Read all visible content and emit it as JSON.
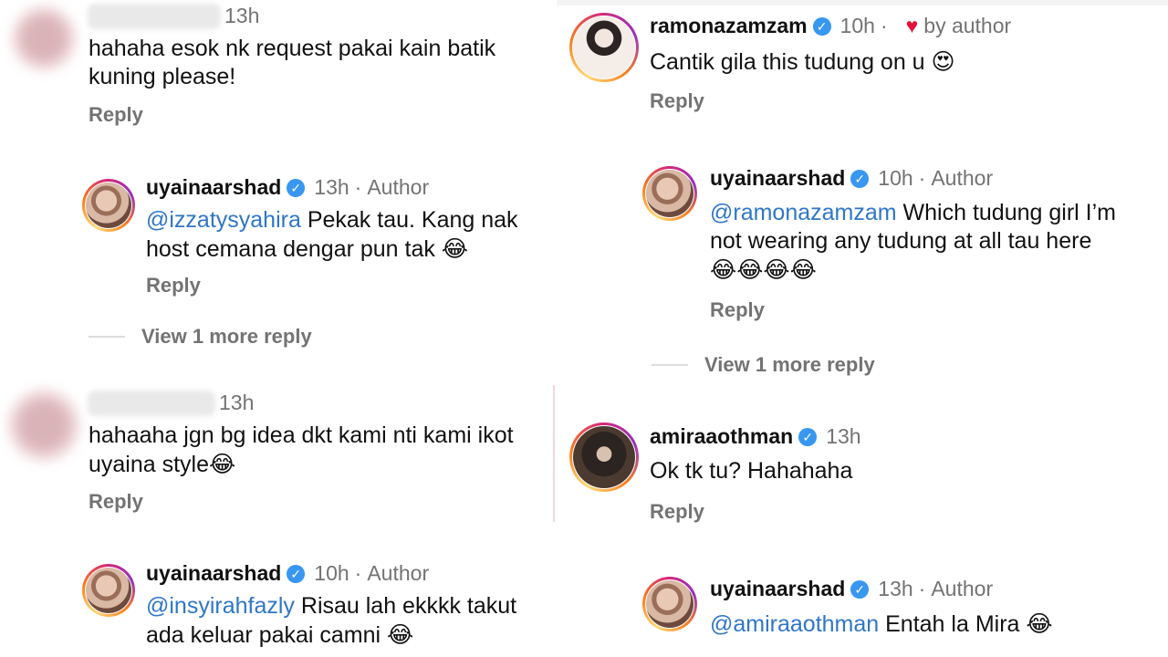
{
  "left": {
    "comment1": {
      "time": "13h",
      "text": "hahaha esok nk request pakai kain batik kuning please!",
      "reply_label": "Reply"
    },
    "reply1": {
      "username": "uyainaarshad",
      "time": "13h",
      "author_label": "Author",
      "mention": "@izzatysyahira",
      "text": " Pekak tau. Kang nak host cemana dengar pun tak ",
      "emoji": "😂",
      "reply_label": "Reply"
    },
    "view_more": "View 1 more reply",
    "comment2": {
      "time": "13h",
      "text": "hahaahа jgn bg idea dkt kami nti kami ikot uyaina style",
      "emoji": "😂",
      "reply_label": "Reply"
    },
    "reply2": {
      "username": "uyainaarshad",
      "time": "10h",
      "author_label": "Author",
      "mention": "@insyirahfazly",
      "text": " Risau lah ekkkk takut ada keluar pakai camni ",
      "emoji": "😂"
    }
  },
  "right": {
    "comment1": {
      "username": "ramonazamzam",
      "time": "10h",
      "liked_label": "by author",
      "text": "Cantik gila this tudung on u ",
      "emoji": "😍",
      "reply_label": "Reply"
    },
    "reply1": {
      "username": "uyainaarshad",
      "time": "10h",
      "author_label": "Author",
      "mention": "@ramonazamzam",
      "text": " Which tudung girl I’m not wearing any tudung at all tau here ",
      "emoji": "😂😂😂😂",
      "reply_label": "Reply"
    },
    "view_more": "View 1 more reply",
    "comment2": {
      "username": "amiraaothman",
      "time": "13h",
      "text": "Ok tk tu? Hahahaha",
      "reply_label": "Reply"
    },
    "reply2": {
      "username": "uyainaarshad",
      "time": "13h",
      "author_label": "Author",
      "mention": "@amiraaothman",
      "text": " Entah la Mira ",
      "emoji": "😂"
    }
  },
  "colors": {
    "mention": "#2f76c6",
    "verified": "#3897f0",
    "heart": "#e0143c",
    "muted": "#737373"
  },
  "icons": {
    "verified": "verified-badge-icon",
    "heart": "heart-icon"
  }
}
